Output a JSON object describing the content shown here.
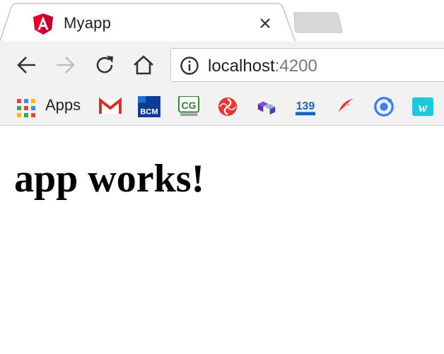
{
  "tab": {
    "title": "Myapp",
    "active_color": "#ffffff",
    "inactive_color": "#d8d8d8"
  },
  "toolbar": {
    "url_host": "localhost",
    "url_port": ":4200"
  },
  "bookmarks": {
    "apps_label": "Apps",
    "items": [
      "gmail-icon",
      "bcm-icon",
      "cg-icon",
      "swirl-icon",
      "cubes-icon",
      "139-mail-icon",
      "feather-icon",
      "ionic-icon",
      "w-icon"
    ]
  },
  "page": {
    "heading": "app works!"
  },
  "colors": {
    "angular_red": "#dd0031",
    "chrome_toolbar": "#f2f2f2",
    "forward_disabled": "#bdbdbd"
  }
}
